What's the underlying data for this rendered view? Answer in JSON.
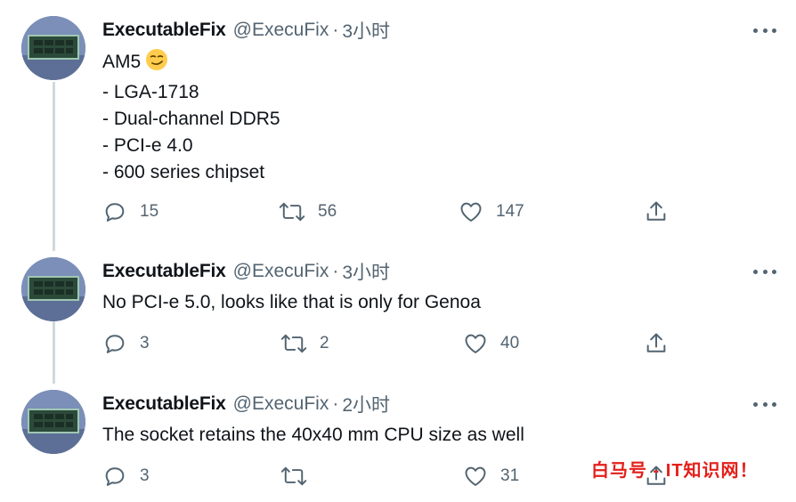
{
  "tweets": [
    {
      "display_name": "ExecutableFix",
      "handle": "@ExecuFix",
      "separator": "·",
      "time": "3小时",
      "lines": [
        "AM5",
        "- LGA-1718",
        "- Dual-channel DDR5",
        "- PCI-e 4.0",
        "- 600 series chipset"
      ],
      "emoji": "smirking-face-emoji",
      "replies": "15",
      "retweets": "56",
      "likes": "147"
    },
    {
      "display_name": "ExecutableFix",
      "handle": "@ExecuFix",
      "separator": "·",
      "time": "3小时",
      "lines": [
        "No PCI-e 5.0, looks like that is only for Genoa"
      ],
      "replies": "3",
      "retweets": "2",
      "likes": "40"
    },
    {
      "display_name": "ExecutableFix",
      "handle": "@ExecuFix",
      "separator": "·",
      "time": "2小时",
      "lines": [
        "The socket retains the 40x40 mm CPU size as well"
      ],
      "replies": "3",
      "retweets": "",
      "likes": "31"
    }
  ],
  "icons": {
    "reply": "reply-icon",
    "retweet": "retweet-icon",
    "like": "like-icon",
    "share": "share-icon",
    "more": "more-icon"
  },
  "colors": {
    "text": "#0f1419",
    "secondary": "#536471",
    "thread_line": "#cfd9de",
    "watermark": "#e3201b"
  },
  "watermark": "白马号 - IT知识网！"
}
